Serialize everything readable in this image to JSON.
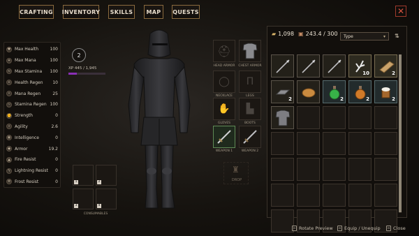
{
  "tabs": [
    {
      "label": "CRAFTING"
    },
    {
      "label": "INVENTORY"
    },
    {
      "label": "SKILLS"
    },
    {
      "label": "MAP"
    },
    {
      "label": "QUESTS"
    }
  ],
  "close_label": "✕",
  "stats": [
    {
      "label": "Max Health",
      "value": "100",
      "icon": "heart-icon"
    },
    {
      "label": "Max Mana",
      "value": "100",
      "icon": "mana-icon"
    },
    {
      "label": "Max Stamina",
      "value": "100",
      "icon": "stamina-icon"
    },
    {
      "label": "Health Regen",
      "value": "10",
      "icon": "plus-icon"
    },
    {
      "label": "Mana Regen",
      "value": "25",
      "icon": "drop-icon"
    },
    {
      "label": "Stamina Regen",
      "value": "100",
      "icon": "wind-icon"
    },
    {
      "label": "Strength",
      "value": "0",
      "icon": "fist-icon"
    },
    {
      "label": "Agility",
      "value": "2.6",
      "icon": "boot-icon"
    },
    {
      "label": "Intelligence",
      "value": "0",
      "icon": "brain-icon"
    },
    {
      "label": "Armor",
      "value": "19.2",
      "icon": "shield-icon"
    },
    {
      "label": "Fire Resist",
      "value": "0",
      "icon": "fire-icon"
    },
    {
      "label": "Lightning Resist",
      "value": "0",
      "icon": "lightning-icon"
    },
    {
      "label": "Frost Resist",
      "value": "0",
      "icon": "snowflake-icon"
    }
  ],
  "character": {
    "level": "2",
    "xp_text": "XP 445 / 1,945",
    "xp_progress": 0.23
  },
  "equipment": {
    "head_armor": "HEAD ARMOR",
    "chest_armor": "CHEST ARMOR",
    "necklace": "NECKLACE",
    "legs": "LEGS",
    "gloves": "GLOVES",
    "boots": "BOOTS",
    "weapon1": "WEAPON 1",
    "weapon2": "WEAPON 2",
    "drop": "DROP",
    "consumables": "CONSUMABLES",
    "consumable_slots": [
      "1",
      "2",
      "3",
      "4"
    ]
  },
  "inventory": {
    "gold": "1,098",
    "weight": "243.4 / 300",
    "type_filter": "Type",
    "sort_icon": "⇅",
    "items": [
      {
        "name": "spear",
        "qty": ""
      },
      {
        "name": "spear",
        "qty": ""
      },
      {
        "name": "spear",
        "qty": ""
      },
      {
        "name": "branch",
        "qty": "10"
      },
      {
        "name": "wood-plank",
        "qty": "2"
      },
      {
        "name": "ingot",
        "qty": "2"
      },
      {
        "name": "bread",
        "qty": ""
      },
      {
        "name": "green-potion",
        "qty": "2"
      },
      {
        "name": "orange-potion",
        "qty": "2"
      },
      {
        "name": "ale-mug",
        "qty": "2"
      },
      {
        "name": "chest-armor",
        "qty": ""
      }
    ]
  },
  "footer": {
    "rotate": "Rotate Preview",
    "equip": "Equip / Unequip",
    "close": "Close"
  }
}
